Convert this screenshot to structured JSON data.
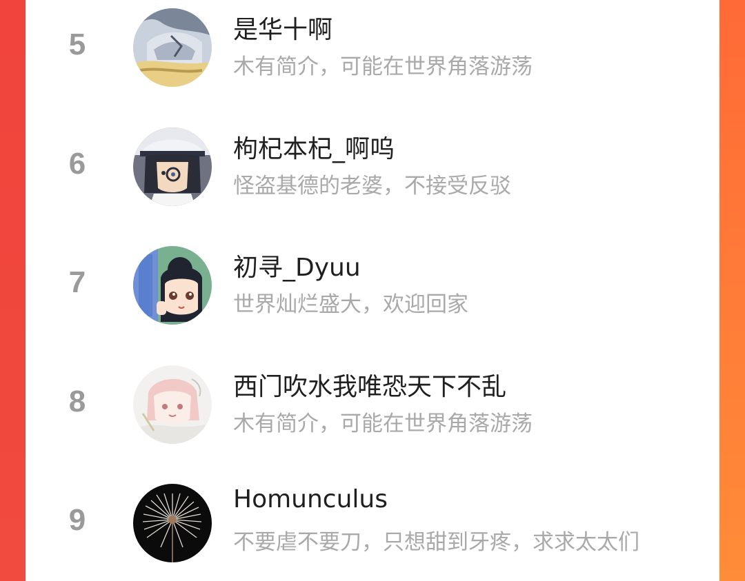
{
  "leaderboard": {
    "rows": [
      {
        "rank": "5",
        "name": "是华十啊",
        "bio": "木有简介，可能在世界角落游荡",
        "avatar": "anime-avatar-kaito-icon"
      },
      {
        "rank": "6",
        "name": "枸杞本杞_啊呜",
        "bio": "怪盗基德的老婆，不接受反驳",
        "avatar": "anime-avatar-conan-icon"
      },
      {
        "rank": "7",
        "name": "初寻_Dyuu",
        "bio": "世界灿烂盛大，欢迎回家",
        "avatar": "anime-avatar-girl-icon"
      },
      {
        "rank": "8",
        "name": "西门吹水我唯恐天下不乱",
        "bio": "木有简介，可能在世界角落游荡",
        "avatar": "anime-avatar-sketch-icon"
      },
      {
        "rank": "9",
        "name": "Homunculus",
        "bio": "不要虐不要刀，只想甜到牙疼，求求太太们",
        "avatar": "dandelion-avatar-icon"
      }
    ]
  },
  "colors": {
    "left_edge": "#f0443c",
    "right_edge": "#ff8c38",
    "rank_text": "#9a9a9a",
    "name_text": "#1f1f1f",
    "bio_text": "#a9a9a9"
  }
}
